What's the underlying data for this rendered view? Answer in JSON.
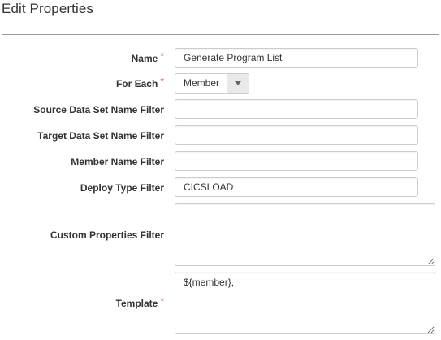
{
  "dialog": {
    "title": "Edit Properties"
  },
  "required_mark": "*",
  "fields": {
    "name": {
      "label": "Name",
      "value": "Generate Program List",
      "required": true
    },
    "for_each": {
      "label": "For Each",
      "selected": "Member",
      "required": true
    },
    "source_filter": {
      "label": "Source Data Set Name Filter",
      "value": ""
    },
    "target_filter": {
      "label": "Target Data Set Name Filter",
      "value": ""
    },
    "member_filter": {
      "label": "Member Name Filter",
      "value": ""
    },
    "deploy_type_filter": {
      "label": "Deploy Type Filter",
      "value": "CICSLOAD"
    },
    "custom_properties_filter": {
      "label": "Custom Properties Filter",
      "value": ""
    },
    "template": {
      "label": "Template",
      "value": "${member},",
      "required": true
    }
  },
  "colors": {
    "required": "#d9534f",
    "border": "#cccccc",
    "divider": "#9a9a9a"
  },
  "icons": {
    "select_arrow": "caret-down-icon"
  }
}
